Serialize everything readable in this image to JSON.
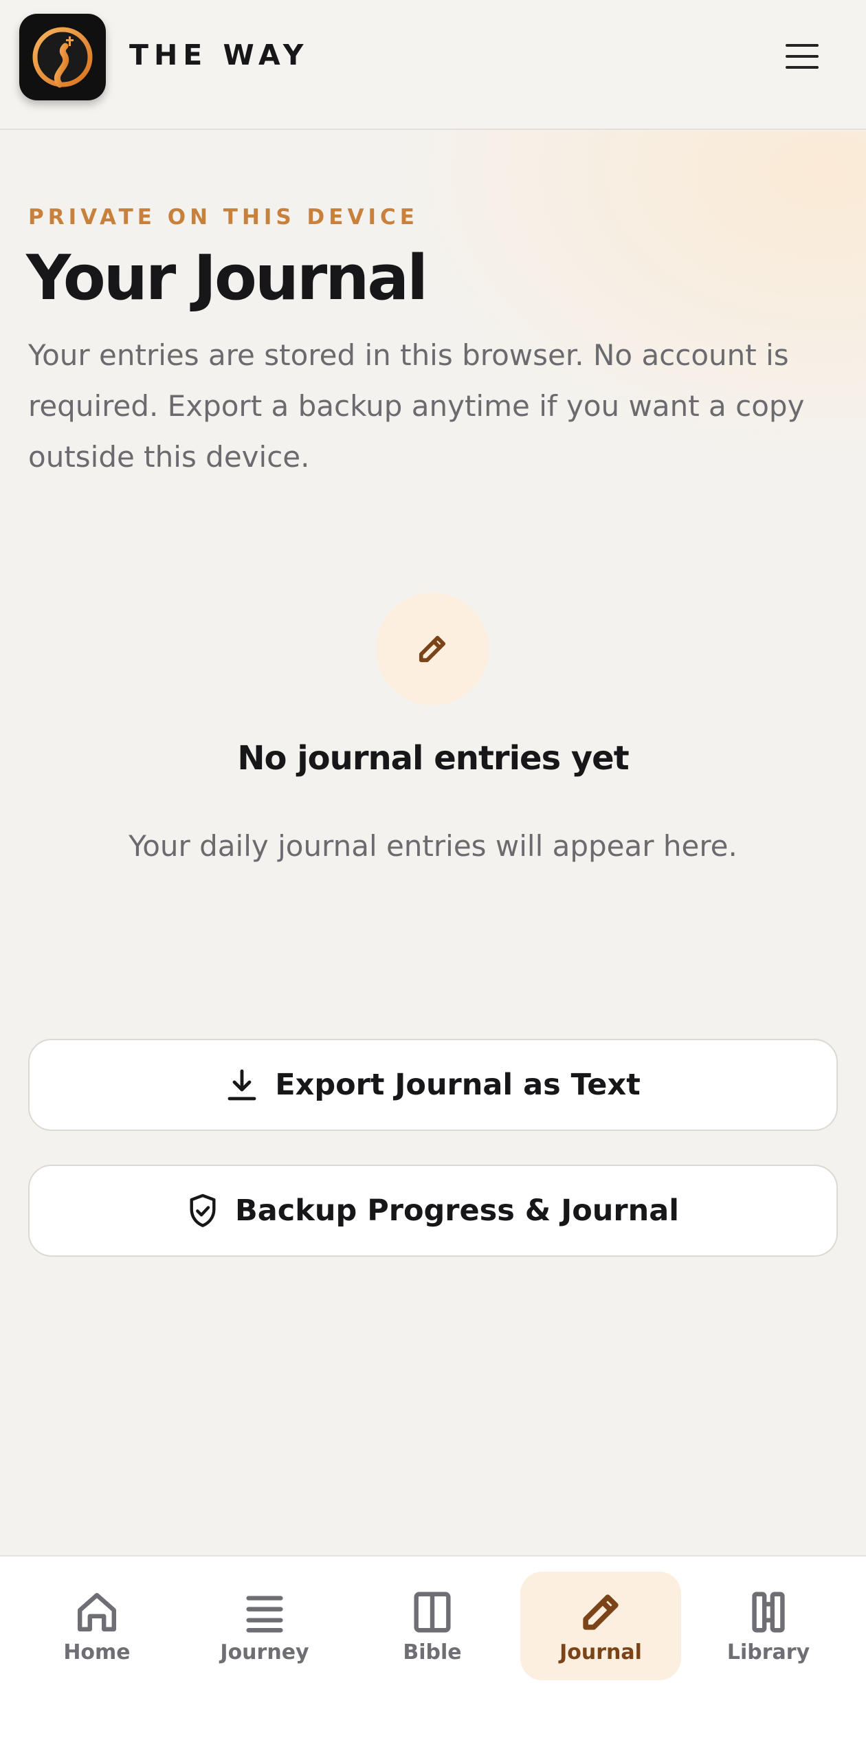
{
  "header": {
    "brand": "THE WAY",
    "logo_icon": "path-cross-logo",
    "menu_icon": "hamburger-menu-icon"
  },
  "main": {
    "eyebrow": "PRIVATE ON THIS DEVICE",
    "title": "Your Journal",
    "description": "Your entries are stored in this browser. No account is required. Export a backup anytime if you want a copy outside this device."
  },
  "empty_state": {
    "icon": "pencil-icon",
    "title": "No journal entries yet",
    "subtitle": "Your daily journal entries will appear here."
  },
  "actions": {
    "export_label": "Export Journal as Text",
    "backup_label": "Backup Progress & Journal"
  },
  "nav": {
    "items": [
      {
        "label": "Home",
        "icon": "home-icon",
        "active": false
      },
      {
        "label": "Journey",
        "icon": "list-icon",
        "active": false
      },
      {
        "label": "Bible",
        "icon": "book-icon",
        "active": false
      },
      {
        "label": "Journal",
        "icon": "pencil-icon",
        "active": true
      },
      {
        "label": "Library",
        "icon": "library-icon",
        "active": false
      }
    ]
  },
  "colors": {
    "accent": "#c7813c",
    "active_nav_bg": "#fcefe0",
    "active_nav_fg": "#7a4418",
    "background": "#f4f2ee"
  }
}
